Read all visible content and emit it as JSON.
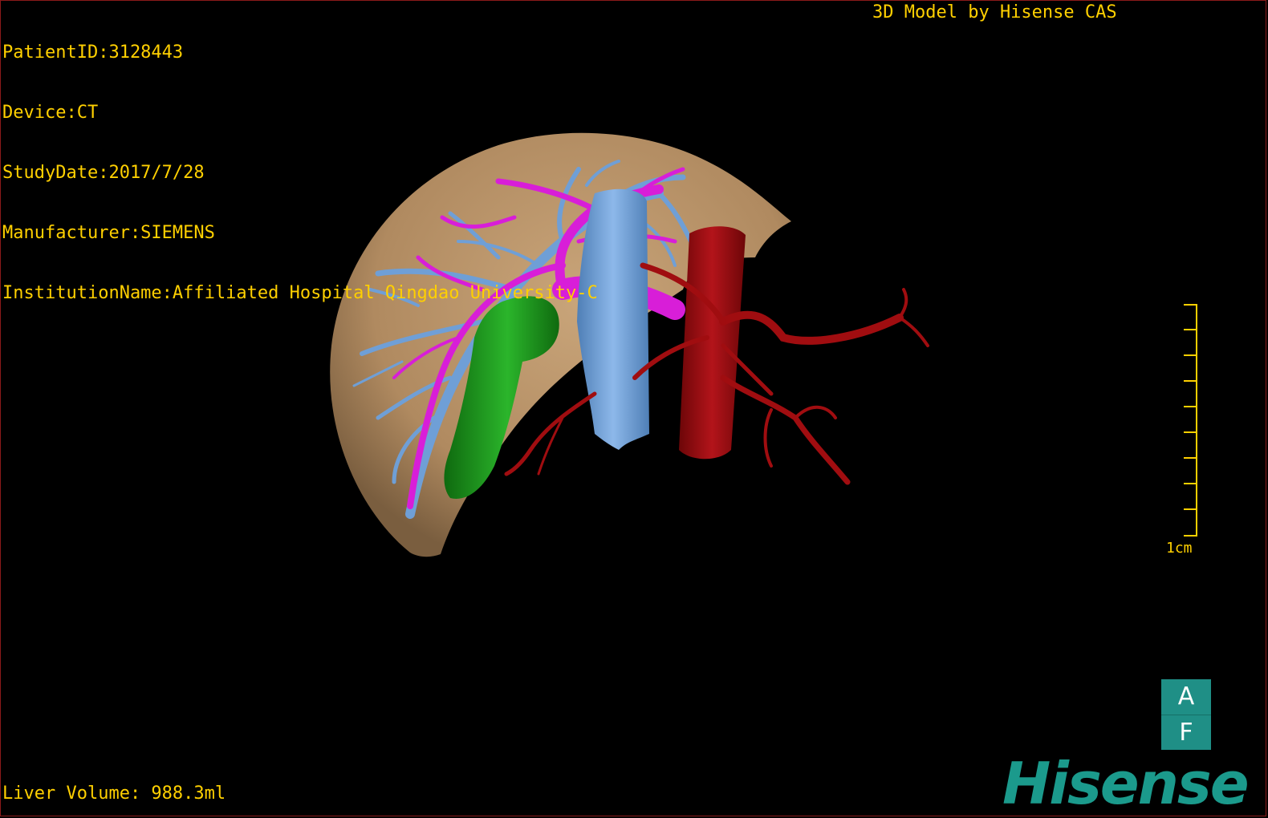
{
  "patient_info": {
    "patient_id": "PatientID:3128443",
    "device": "Device:CT",
    "study_date": "StudyDate:2017/7/28",
    "manufacturer": "Manufacturer:SIEMENS",
    "institution": "InstitutionName:Affiliated Hospital Qingdao University-C"
  },
  "model_credit": "3D Model by Hisense CAS",
  "liver_volume": "Liver Volume: 988.3ml",
  "scale_bar": {
    "label": "1cm"
  },
  "orientation_cube": {
    "top_label": "A",
    "bottom_label": "F"
  },
  "brand": "Hisense",
  "colors": {
    "overlay_text": "#ffd000",
    "liver": "#b8946a",
    "hepatic_vein": "#6f9fd6",
    "portal_vein": "#d81ed8",
    "artery_aorta": "#a00d10",
    "tumor": "#1f9a1f",
    "ivc": "#6fa3dd",
    "brand": "#1b9a8c"
  }
}
